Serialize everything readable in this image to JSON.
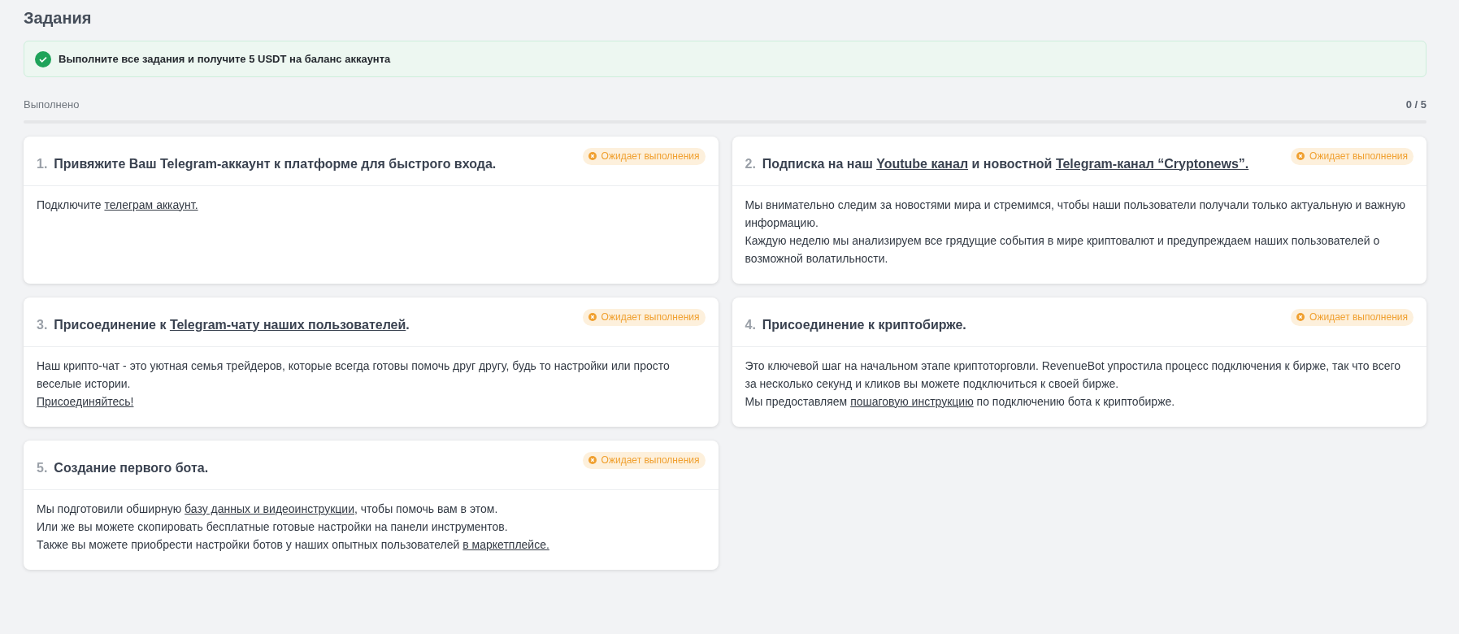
{
  "page_title": "Задания",
  "banner": {
    "text": "Выполните все задания и получите 5 USDT на баланс аккаунта"
  },
  "progress": {
    "label": "Выполнено",
    "count": "0 / 5"
  },
  "tasks": [
    {
      "number": "1.",
      "title": [
        {
          "text": "Привяжите Ваш Telegram-аккаунт к платформе для быстрого входа.",
          "link": false
        }
      ],
      "status": {
        "kind": "pending",
        "label": "Ожидает выполнения"
      },
      "paragraphs": [
        [
          {
            "text": "Подключите ",
            "link": false
          },
          {
            "text": "телеграм аккаунт.",
            "link": true
          }
        ]
      ]
    },
    {
      "number": "2.",
      "title": [
        {
          "text": "Подписка на наш ",
          "link": false
        },
        {
          "text": "Youtube канал",
          "link": true
        },
        {
          "text": " и новостной ",
          "link": false
        },
        {
          "text": "Telegram-канал “Cryptonews”.",
          "link": true
        }
      ],
      "status": {
        "kind": "pending",
        "label": "Ожидает выполнения"
      },
      "paragraphs": [
        [
          {
            "text": "Мы внимательно следим за новостями мира и стремимся, чтобы наши пользователи получали только актуальную и важную информацию.",
            "link": false
          }
        ],
        [
          {
            "text": "Каждую неделю мы анализируем все грядущие события в мире криптовалют и предупреждаем наших пользователей о возможной волатильности.",
            "link": false
          }
        ]
      ]
    },
    {
      "number": "3.",
      "title": [
        {
          "text": "Присоединение к ",
          "link": false
        },
        {
          "text": "Telegram-чату наших пользователей",
          "link": true
        },
        {
          "text": ".",
          "link": false
        }
      ],
      "status": {
        "kind": "pending",
        "label": "Ожидает выполнения"
      },
      "paragraphs": [
        [
          {
            "text": "Наш крипто-чат - это уютная семья трейдеров, которые всегда готовы помочь друг другу, будь то настройки или просто веселые истории.",
            "link": false
          }
        ],
        [
          {
            "text": "Присоединяйтесь!",
            "link": true
          }
        ]
      ]
    },
    {
      "number": "4.",
      "title": [
        {
          "text": "Присоединение к криптобирже.",
          "link": false
        }
      ],
      "status": {
        "kind": "pending",
        "label": "Ожидает выполнения"
      },
      "paragraphs": [
        [
          {
            "text": "Это ключевой шаг на начальном этапе криптоторговли. RevenueBot упростила процесс подключения к бирже, так что всего за несколько секунд и кликов вы можете подключиться к своей бирже.",
            "link": false
          }
        ],
        [
          {
            "text": "Мы предоставляем ",
            "link": false
          },
          {
            "text": "пошаговую инструкцию",
            "link": true
          },
          {
            "text": " по подключению бота к криптобирже.",
            "link": false
          }
        ]
      ]
    },
    {
      "number": "5.",
      "title": [
        {
          "text": "Создание первого бота.",
          "link": false
        }
      ],
      "status": {
        "kind": "pending",
        "label": "Ожидает выполнения"
      },
      "paragraphs": [
        [
          {
            "text": "Мы подготовили обширную ",
            "link": false
          },
          {
            "text": "базу данных и видеоинструкции",
            "link": true
          },
          {
            "text": ", чтобы помочь вам в этом.",
            "link": false
          }
        ],
        [
          {
            "text": "Или же вы можете скопировать бесплатные готовые настройки на панели инструментов.",
            "link": false
          }
        ],
        [
          {
            "text": "Также вы можете приобрести настройки ботов у наших опытных пользователей ",
            "link": false
          },
          {
            "text": "в маркетплейсе.",
            "link": true
          }
        ]
      ]
    }
  ]
}
